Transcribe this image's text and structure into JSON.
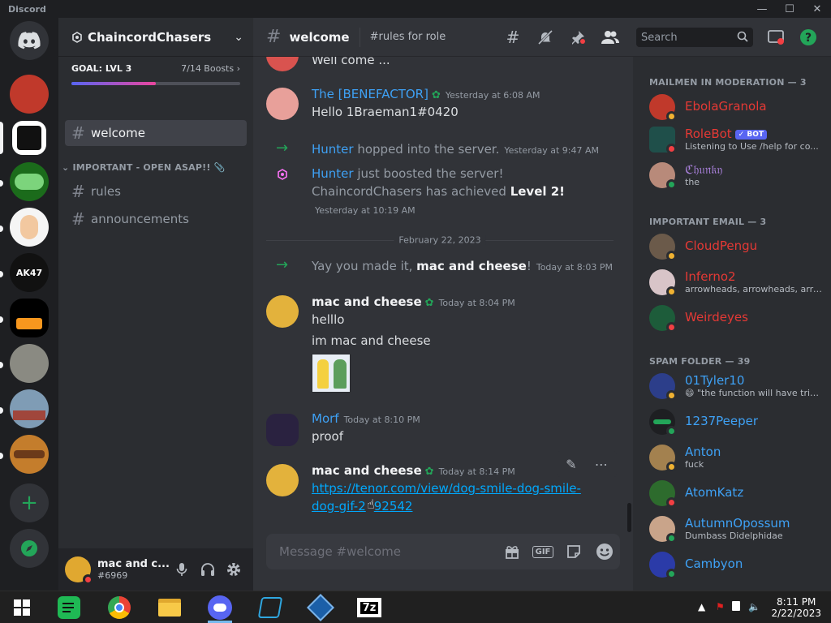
{
  "window": {
    "brand": "Discord"
  },
  "server": {
    "name": "ChaincordChasers",
    "boost_goal": "GOAL: LVL 3",
    "boost_count": "7/14 Boosts",
    "boost_progress": 0.5
  },
  "channels": {
    "welcome": "welcome",
    "category": "IMPORTANT - OPEN ASAP!! 📎",
    "rules": "rules",
    "announcements": "announcements"
  },
  "user": {
    "name": "mac and c...",
    "tag": "#6969"
  },
  "header": {
    "channel": "welcome",
    "topic": "#rules for role",
    "search_placeholder": "Search"
  },
  "messages": {
    "m0_text": "Well come ...",
    "m1_author": "The [BENEFACTOR]",
    "m1_time": "Yesterday at 6:08 AM",
    "m1_text": "Hello 1Braeman1#0420",
    "s1_user": "Hunter",
    "s1_text": " hopped into the server.",
    "s1_time": "Yesterday at 9:47 AM",
    "s2_user": "Hunter",
    "s2_text": " just boosted the server!",
    "s2_line2_a": "ChaincordChasers has achieved ",
    "s2_line2_b": "Level 2!",
    "s2_time": "Yesterday at 10:19 AM",
    "date_divider": "February 22, 2023",
    "s3_text_a": "Yay you made it, ",
    "s3_user": "mac and cheese",
    "s3_text_b": "!",
    "s3_time": "Today at 8:03 PM",
    "m2_author": "mac and cheese",
    "m2_time": "Today at 8:04 PM",
    "m2_line1": "helllo",
    "m2_line2": "im mac and cheese",
    "m3_author": "Morf",
    "m3_time": "Today at 8:10 PM",
    "m3_text": "proof",
    "m4_author": "mac and cheese",
    "m4_time": "Today at 8:14 PM",
    "m4_link1": "https://tenor.com/view/dog-smile-dog-smile-",
    "m4_link2": "dog-gif-2",
    "m4_link3": "92542"
  },
  "input": {
    "placeholder": "Message #welcome",
    "gif_label": "GIF"
  },
  "members": {
    "cat1": "MAILMEN IN MODERATION — 3",
    "cat2": "IMPORTANT EMAIL — 3",
    "cat3": "SPAM FOLDER — 39",
    "bot_badge": "✓ BOT",
    "list": [
      {
        "name": "EbolaGranola",
        "sub": ""
      },
      {
        "name": "RoleBot",
        "sub": "Listening to Use /help for co..."
      },
      {
        "name": "ℭ𝔥𝔲𝔫𝔨𝔶",
        "sub": "the"
      },
      {
        "name": "CloudPengu",
        "sub": ""
      },
      {
        "name": "Inferno2",
        "sub": "arrowheads, arrowheads, arro..."
      },
      {
        "name": "Weirdeyes",
        "sub": ""
      },
      {
        "name": "01Tyler10",
        "sub": "😄 \"the function will have trin..."
      },
      {
        "name": "1237Peeper",
        "sub": ""
      },
      {
        "name": "Anton",
        "sub": "fuck"
      },
      {
        "name": "AtomKatz",
        "sub": ""
      },
      {
        "name": "AutumnOpossum",
        "sub": "Dumbass Didelphidae"
      },
      {
        "name": "Cambyon",
        "sub": ""
      }
    ]
  },
  "taskbar": {
    "time": "8:11 PM",
    "date": "2/22/2023",
    "sevenzip": "7z"
  },
  "colors": {
    "blurple": "#5865f2",
    "online": "#23a559",
    "dnd": "#f23f43",
    "idle": "#f0b232",
    "link": "#00a8fc"
  }
}
